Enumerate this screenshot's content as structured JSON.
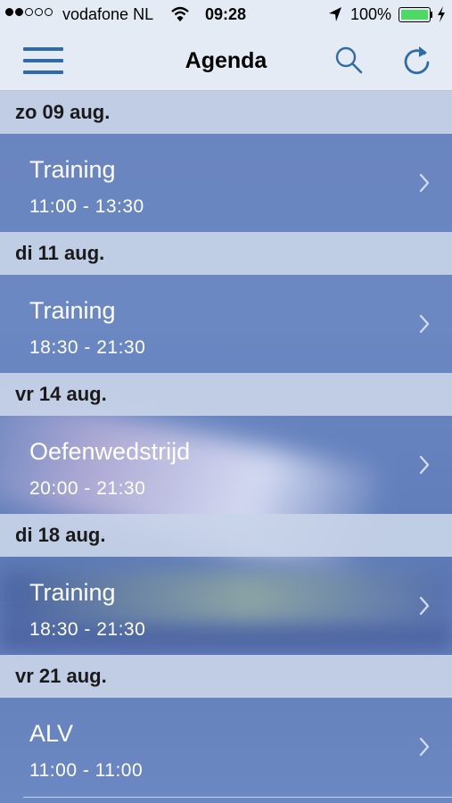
{
  "status_bar": {
    "carrier": "vodafone NL",
    "time": "09:28",
    "battery_percent": "100%",
    "signal_bars_filled": 2,
    "signal_bars_total": 5,
    "battery_color": "#4cd964"
  },
  "nav": {
    "title": "Agenda",
    "left_icon": "menu-icon",
    "right_icons": [
      "search-icon",
      "refresh-icon"
    ],
    "accent_color": "#2f6ba8"
  },
  "agenda": {
    "days": [
      {
        "header": "zo 09 aug.",
        "event": {
          "title": "Training",
          "time": "11:00 - 13:30"
        }
      },
      {
        "header": "di 11 aug.",
        "event": {
          "title": "Training",
          "time": "18:30 - 21:30"
        }
      },
      {
        "header": "vr 14 aug.",
        "event": {
          "title": "Oefenwedstrijd",
          "time": "20:00 - 21:30"
        }
      },
      {
        "header": "di 18 aug.",
        "event": {
          "title": "Training",
          "time": "18:30 - 21:30"
        }
      },
      {
        "header": "vr 21 aug.",
        "event": {
          "title": "ALV",
          "time": "11:00 - 11:00"
        }
      }
    ]
  }
}
